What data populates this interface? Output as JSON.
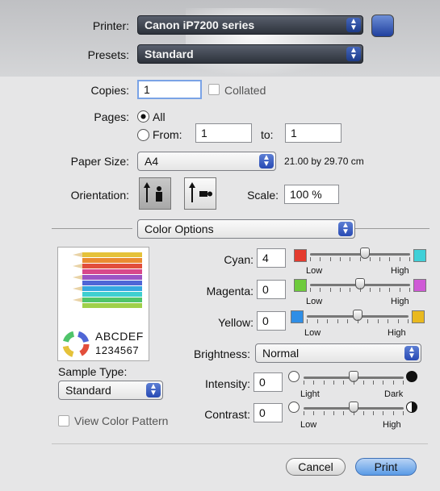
{
  "printer": {
    "label": "Printer:",
    "value": "Canon iP7200 series"
  },
  "presets": {
    "label": "Presets:",
    "value": "Standard"
  },
  "copies": {
    "label": "Copies:",
    "value": "1",
    "collated": "Collated"
  },
  "pages": {
    "label": "Pages:",
    "all": "All",
    "from": "From:",
    "from_value": "1",
    "to": "to:",
    "to_value": "1"
  },
  "paper": {
    "label": "Paper Size:",
    "value": "A4",
    "dims": "21.00 by 29.70 cm"
  },
  "orientation": {
    "label": "Orientation:"
  },
  "scale": {
    "label": "Scale:",
    "value": "100 %"
  },
  "section": {
    "value": "Color Options"
  },
  "preview": {
    "letters": "ABCDEF",
    "numbers": "1234567"
  },
  "sample": {
    "label": "Sample Type:",
    "value": "Standard",
    "view_pattern": "View Color Pattern"
  },
  "color": {
    "cyan": {
      "label": "Cyan:",
      "value": "4",
      "low": "Low",
      "high": "High",
      "level": 0.55
    },
    "magenta": {
      "label": "Magenta:",
      "value": "0",
      "low": "Low",
      "high": "High",
      "level": 0.5
    },
    "yellow": {
      "label": "Yellow:",
      "value": "0",
      "low": "Low",
      "high": "High",
      "level": 0.5
    },
    "brightness": {
      "label": "Brightness:",
      "value": "Normal"
    },
    "intensity": {
      "label": "Intensity:",
      "value": "0",
      "low": "Light",
      "high": "Dark",
      "level": 0.5
    },
    "contrast": {
      "label": "Contrast:",
      "value": "0",
      "low": "Low",
      "high": "High",
      "level": 0.5
    }
  },
  "buttons": {
    "cancel": "Cancel",
    "print": "Print"
  },
  "colors": {
    "accent": "#2f55c2",
    "cyan_low": "#e43b2e",
    "cyan_high": "#3fd0d8",
    "magenta_low": "#6ecb3c",
    "magenta_high": "#cf5ad6",
    "yellow_low": "#2f8ee6",
    "yellow_high": "#e9b91f"
  }
}
